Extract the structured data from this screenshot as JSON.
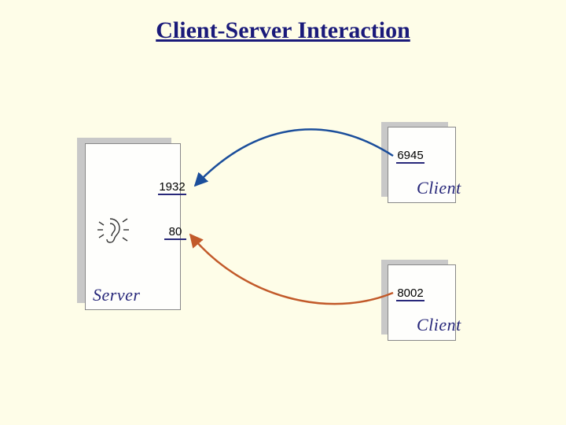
{
  "title": "Client-Server Interaction",
  "server": {
    "label": "Server",
    "ports": {
      "p1": "1932",
      "p2": "80"
    }
  },
  "client1": {
    "label": "Client",
    "port": "6945"
  },
  "client2": {
    "label": "Client",
    "port": "8002"
  },
  "chart_data": {
    "type": "diagram",
    "title": "Client-Server Interaction",
    "nodes": [
      {
        "id": "server",
        "label": "Server",
        "ports": [
          1932,
          80
        ]
      },
      {
        "id": "client1",
        "label": "Client",
        "ports": [
          6945
        ]
      },
      {
        "id": "client2",
        "label": "Client",
        "ports": [
          8002
        ]
      }
    ],
    "edges": [
      {
        "from": "client1",
        "from_port": 6945,
        "to": "server",
        "to_port": 1932,
        "color": "#1b4e9b"
      },
      {
        "from": "client2",
        "from_port": 8002,
        "to": "server",
        "to_port": 80,
        "color": "#c25a2a"
      }
    ]
  }
}
